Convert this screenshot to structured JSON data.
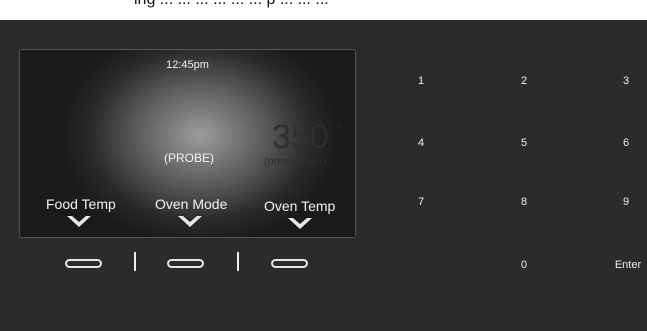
{
  "header": {
    "partial_text": "ing ... ... ... ... ... ... p ... ... ..."
  },
  "display": {
    "time": "12:45pm",
    "mode_text": "(PROBE)",
    "temperature": "350",
    "degree_symbol": "°",
    "hint": "(press enter)"
  },
  "soft_keys": [
    {
      "label": "Food Temp"
    },
    {
      "label": "Oven Mode"
    },
    {
      "label": "Oven Temp"
    }
  ],
  "keypad": {
    "keys": [
      "1",
      "2",
      "3",
      "4",
      "5",
      "6",
      "7",
      "8",
      "9",
      "0",
      "Enter"
    ]
  },
  "colors": {
    "background": "#2b2b2b",
    "screen_highlight": "#9c9c9c",
    "text": "#f2f2f2",
    "dim_text": "#2f2f2f"
  },
  "icons": {
    "chevron": "chevron-down-icon",
    "button": "oval-button"
  }
}
